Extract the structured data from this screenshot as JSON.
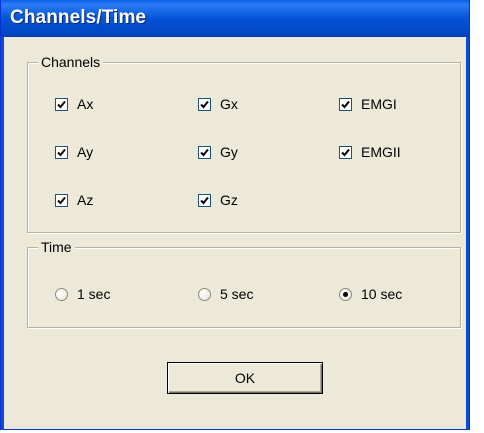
{
  "window": {
    "title": "Channels/Time"
  },
  "channels_group": {
    "label": "Channels",
    "checkboxes": [
      {
        "label": "Ax",
        "checked": true
      },
      {
        "label": "Gx",
        "checked": true
      },
      {
        "label": "EMGI",
        "checked": true
      },
      {
        "label": "Ay",
        "checked": true
      },
      {
        "label": "Gy",
        "checked": true
      },
      {
        "label": "EMGII",
        "checked": true
      },
      {
        "label": "Az",
        "checked": true
      },
      {
        "label": "Gz",
        "checked": true
      }
    ]
  },
  "time_group": {
    "label": "Time",
    "options": [
      {
        "label": "1 sec",
        "selected": false
      },
      {
        "label": "5 sec",
        "selected": false
      },
      {
        "label": "10 sec",
        "selected": true
      }
    ]
  },
  "ok_button": {
    "label": "OK"
  },
  "colors": {
    "titlebar": "#0453d6",
    "dialog_bg": "#ece9d8",
    "check_mark": "#21a121"
  }
}
